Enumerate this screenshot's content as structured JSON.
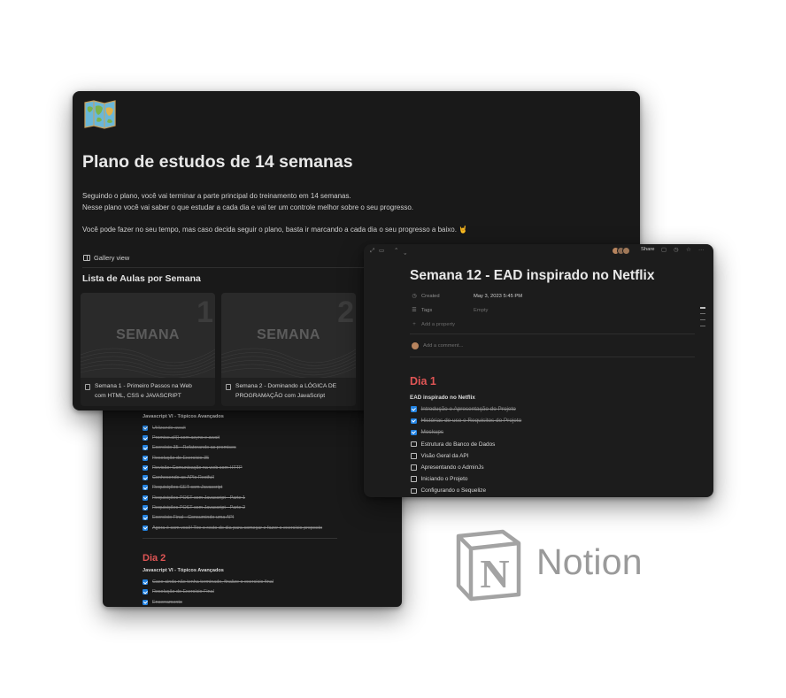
{
  "back_window": {
    "section_title": "Javascript VI - Tópicos Avançados",
    "items": [
      "Utilizando await",
      "Promise.all() com async e await",
      "Exercício 35 - Refatorando as promises",
      "Resolução do Exercício 35",
      "Revisão: Comunicação na web com HTTP",
      "Conhecendo as APIs Restfull",
      "Requisições GET com Javascript",
      "Requisições POST com Javascript - Parte 1",
      "Requisições POST com Javascript - Parte 2",
      "Exercício Final - Consumindo uma API",
      "Agora é com você! Tire o resto do dia para começar e fazer o exercício proposto"
    ],
    "day_heading": "Dia 2",
    "day2_title": "Javascript VI - Tópicos Avançados",
    "day2_items": [
      "Caso ainda não tenha terminado, finalize o exercício final",
      "Resolução do Exercício Final",
      "Encerramento"
    ]
  },
  "main_window": {
    "page_title": "Plano de estudos de 14 semanas",
    "paragraph_1": "Seguindo o plano, você vai terminar a parte principal do treinamento em 14 semanas.",
    "paragraph_2": "Nesse plano você vai saber o que estudar a cada dia e vai ter um controle melhor sobre o seu progresso.",
    "paragraph_3": "Você pode fazer no seu tempo, mas caso decida seguir o plano, basta ir marcando a cada dia o seu progresso a baixo. 🤘",
    "view_label": "Gallery view",
    "database_title": "Lista de Aulas por Semana",
    "cards": [
      {
        "cover_word": "SEMANA",
        "cover_number": "1",
        "title": "Semana 1 - Primeiro Passos na Web com HTML, CSS e JAVASCRIPT"
      },
      {
        "cover_word": "SEMANA",
        "cover_number": "2",
        "title": "Semana 2 - Dominando a LÓGICA DE PROGRAMAÇÃO com JavaScript"
      }
    ]
  },
  "right_window": {
    "topbar": {
      "share_label": "Share"
    },
    "page_title": "Semana 12 - EAD inspirado no Netflix",
    "properties": [
      {
        "label": "Created",
        "value": "May 3, 2023 5:45 PM",
        "icon": "clock-icon"
      },
      {
        "label": "Tags",
        "value": "Empty",
        "icon": "list-icon"
      }
    ],
    "add_property_label": "Add a property",
    "comment_placeholder": "Add a comment...",
    "day_heading": "Dia 1",
    "section_title": "EAD inspirado no Netflix",
    "tasks": [
      {
        "label": "Introdução e Apresentação do Projeto",
        "done": true
      },
      {
        "label": "Histórias de uso e Requisitos do Projeto",
        "done": true
      },
      {
        "label": "Mockups",
        "done": true
      },
      {
        "label": "Estrutura do Banco de Dados",
        "done": false
      },
      {
        "label": "Visão Geral da API",
        "done": false
      },
      {
        "label": "Apresentando o AdminJs",
        "done": false
      },
      {
        "label": "Iniciando o Projeto",
        "done": false
      },
      {
        "label": "Configurando o Sequelize",
        "done": false
      }
    ]
  },
  "branding": {
    "wordmark": "Notion",
    "logo_letter": "N"
  },
  "colors": {
    "accent_blue": "#2383e2",
    "heading_red": "#e05555",
    "window_bg": "#191919"
  }
}
